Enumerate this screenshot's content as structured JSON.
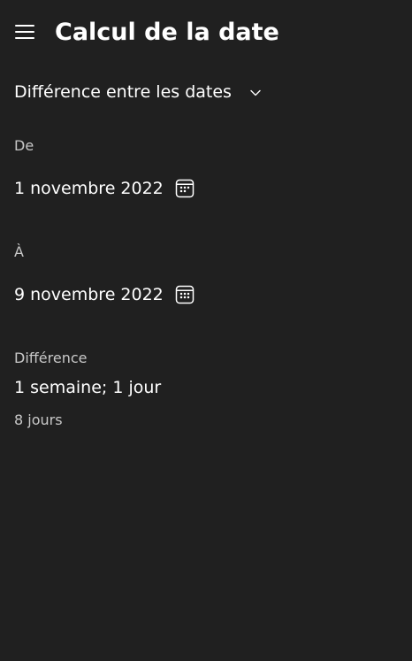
{
  "header": {
    "title": "Calcul de la date",
    "menu_icon": "hamburger-menu-icon"
  },
  "mode": {
    "selected": "Différence entre les dates",
    "icon": "chevron-down-icon"
  },
  "from": {
    "label": "De",
    "date": "1 novembre 2022",
    "icon": "calendar-icon"
  },
  "to": {
    "label": "À",
    "date": "9 novembre 2022",
    "icon": "calendar-icon"
  },
  "result": {
    "label": "Différence",
    "value": "1 semaine; 1 jour",
    "days": "8 jours"
  },
  "colors": {
    "background": "#202020",
    "text_primary": "#ffffff",
    "text_secondary": "#c8c8c8"
  }
}
